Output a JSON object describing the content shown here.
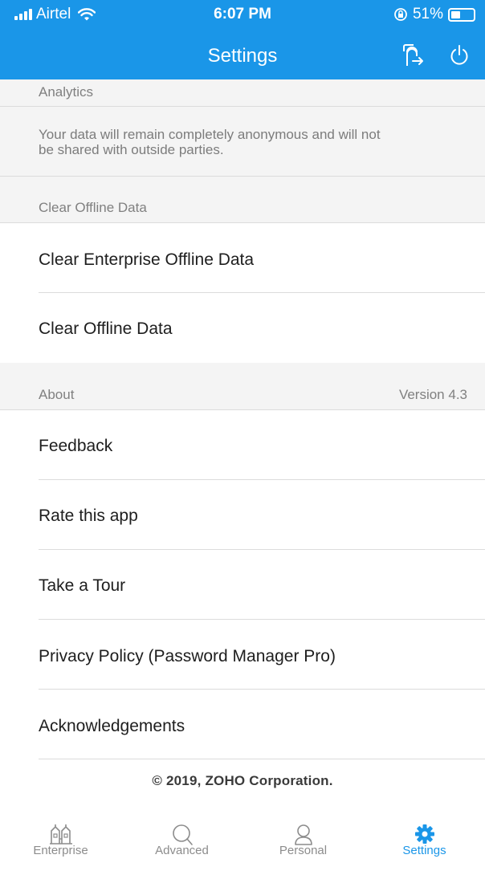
{
  "status_bar": {
    "carrier": "Airtel",
    "time": "6:07 PM",
    "battery": "51%",
    "battery_level": 0.51
  },
  "header": {
    "title": "Settings",
    "icons": [
      "switch-account-icon",
      "power-icon"
    ],
    "color": "#1a96e8"
  },
  "analytics": {
    "header": "Analytics",
    "description_line1": "Your data will remain completely anonymous and will not",
    "description_line2": "be shared with outside parties."
  },
  "offline": {
    "header": "Clear Offline Data",
    "items": [
      {
        "label": "Clear Enterprise Offline Data"
      },
      {
        "label": "Clear Offline Data"
      }
    ]
  },
  "about": {
    "header": "About",
    "version": "Version 4.3",
    "items": [
      {
        "label": "Feedback"
      },
      {
        "label": "Rate this app"
      },
      {
        "label": "Take a Tour"
      },
      {
        "label": "Privacy Policy (Password Manager Pro)"
      },
      {
        "label": "Acknowledgements"
      }
    ]
  },
  "footer": {
    "copyright": "© 2019, ZOHO Corporation."
  },
  "tabbar": {
    "tabs": [
      {
        "label": "Enterprise",
        "icon": "buildings-icon",
        "active": false
      },
      {
        "label": "Advanced",
        "icon": "search-icon",
        "active": false
      },
      {
        "label": "Personal",
        "icon": "person-icon",
        "active": false
      },
      {
        "label": "Settings",
        "icon": "gear-icon",
        "active": true
      }
    ],
    "active_color": "#1a96e8"
  }
}
